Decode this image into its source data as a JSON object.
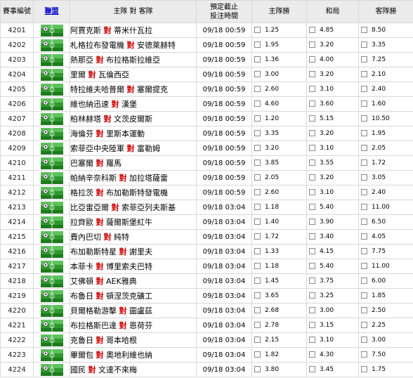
{
  "headers": {
    "match_no": "賽事編號",
    "league": "聯盟",
    "teams": "主隊 對 客隊",
    "cutoff_line1": "預定截止",
    "cutoff_line2": "投注時間",
    "home_win": "主隊勝",
    "draw": "和局",
    "away_win": "客隊勝"
  },
  "league_icon": "soccer-league-icon",
  "vs_text": "對",
  "colors": {
    "vs": "#cc0000",
    "header_bg": "#ebebeb",
    "league_link": "#0000cc",
    "pitch": "#2e9a2e"
  },
  "rows": [
    {
      "id": "4201",
      "home": "阿賈克斯",
      "away": "蒂米什瓦拉",
      "time": "09/18 00:59",
      "h": "1.25",
      "d": "4.85",
      "a": "8.50"
    },
    {
      "id": "4202",
      "home": "札格拉布發電機",
      "away": "安德萊赫特",
      "time": "09/18 00:59",
      "h": "1.95",
      "d": "3.20",
      "a": "3.35"
    },
    {
      "id": "4203",
      "home": "熱那亞",
      "away": "布拉格斯拉維亞",
      "time": "09/18 00:59",
      "h": "1.36",
      "d": "4.00",
      "a": "7.25"
    },
    {
      "id": "4204",
      "home": "里爾",
      "away": "瓦倫西亞",
      "time": "09/18 00:59",
      "h": "3.00",
      "d": "3.20",
      "a": "2.10"
    },
    {
      "id": "4205",
      "home": "特拉維夫哈普爾",
      "away": "塞爾提克",
      "time": "09/18 00:59",
      "h": "2.60",
      "d": "3.10",
      "a": "2.40"
    },
    {
      "id": "4206",
      "home": "維也納迅速",
      "away": "漢堡",
      "time": "09/18 00:59",
      "h": "4.60",
      "d": "3.60",
      "a": "1.60"
    },
    {
      "id": "4207",
      "home": "柏林赫塔",
      "away": "文茨皮爾斯",
      "time": "09/18 00:59",
      "h": "1.20",
      "d": "5.15",
      "a": "10.50"
    },
    {
      "id": "4208",
      "home": "海倫芬",
      "away": "里斯本運動",
      "time": "09/18 00:59",
      "h": "3.35",
      "d": "3.20",
      "a": "1.95"
    },
    {
      "id": "4209",
      "home": "索菲亞中央陸軍",
      "away": "富勒姆",
      "time": "09/18 00:59",
      "h": "3.20",
      "d": "3.10",
      "a": "2.05"
    },
    {
      "id": "4210",
      "home": "巴塞爾",
      "away": "羅馬",
      "time": "09/18 00:59",
      "h": "3.85",
      "d": "3.55",
      "a": "1.72"
    },
    {
      "id": "4211",
      "home": "帕納辛奈科斯",
      "away": "加拉塔薩雷",
      "time": "09/18 00:59",
      "h": "2.05",
      "d": "3.20",
      "a": "3.05"
    },
    {
      "id": "4212",
      "home": "格拉茨",
      "away": "布加勒斯特發電機",
      "time": "09/18 00:59",
      "h": "2.60",
      "d": "3.10",
      "a": "2.40"
    },
    {
      "id": "4213",
      "home": "比亞雷亞爾",
      "away": "索菲亞列夫斯基",
      "time": "09/18 03:04",
      "h": "1.18",
      "d": "5.40",
      "a": "11.00"
    },
    {
      "id": "4214",
      "home": "拉齊歐",
      "away": "薩爾斯堡紅牛",
      "time": "09/18 03:04",
      "h": "1.40",
      "d": "3.90",
      "a": "6.50"
    },
    {
      "id": "4215",
      "home": "費內巴切",
      "away": "純特",
      "time": "09/18 03:04",
      "h": "1.72",
      "d": "3.40",
      "a": "4.05"
    },
    {
      "id": "4216",
      "home": "布加勒斯特星",
      "away": "謝里夫",
      "time": "09/18 03:04",
      "h": "1.33",
      "d": "4.15",
      "a": "7.75"
    },
    {
      "id": "4217",
      "home": "本菲卡",
      "away": "博里索夫巴特",
      "time": "09/18 03:04",
      "h": "1.18",
      "d": "5.40",
      "a": "11.00"
    },
    {
      "id": "4218",
      "home": "艾佛頓",
      "away": "AEK雅典",
      "time": "09/18 03:04",
      "h": "1.45",
      "d": "3.75",
      "a": "6.00"
    },
    {
      "id": "4219",
      "home": "布魯日",
      "away": "頓涅茨克礦工",
      "time": "09/18 03:04",
      "h": "3.65",
      "d": "3.25",
      "a": "1.85"
    },
    {
      "id": "4220",
      "home": "貝爾格勒游擊",
      "away": "圖盧茲",
      "time": "09/18 03:04",
      "h": "2.68",
      "d": "3.00",
      "a": "2.50"
    },
    {
      "id": "4221",
      "home": "布拉格斯巴達",
      "away": "恩荷芬",
      "time": "09/18 03:04",
      "h": "2.78",
      "d": "3.15",
      "a": "2.25"
    },
    {
      "id": "4222",
      "home": "克魯日",
      "away": "哥本哈根",
      "time": "09/18 03:04",
      "h": "2.15",
      "d": "3.10",
      "a": "3.00"
    },
    {
      "id": "4223",
      "home": "畢爾包",
      "away": "奧地利維也納",
      "time": "09/18 03:04",
      "h": "1.82",
      "d": "4.30",
      "a": "7.50"
    },
    {
      "id": "4224",
      "home": "國民",
      "away": "文達不來梅",
      "time": "09/18 03:04",
      "h": "3.80",
      "d": "3.45",
      "a": "1.75"
    }
  ]
}
